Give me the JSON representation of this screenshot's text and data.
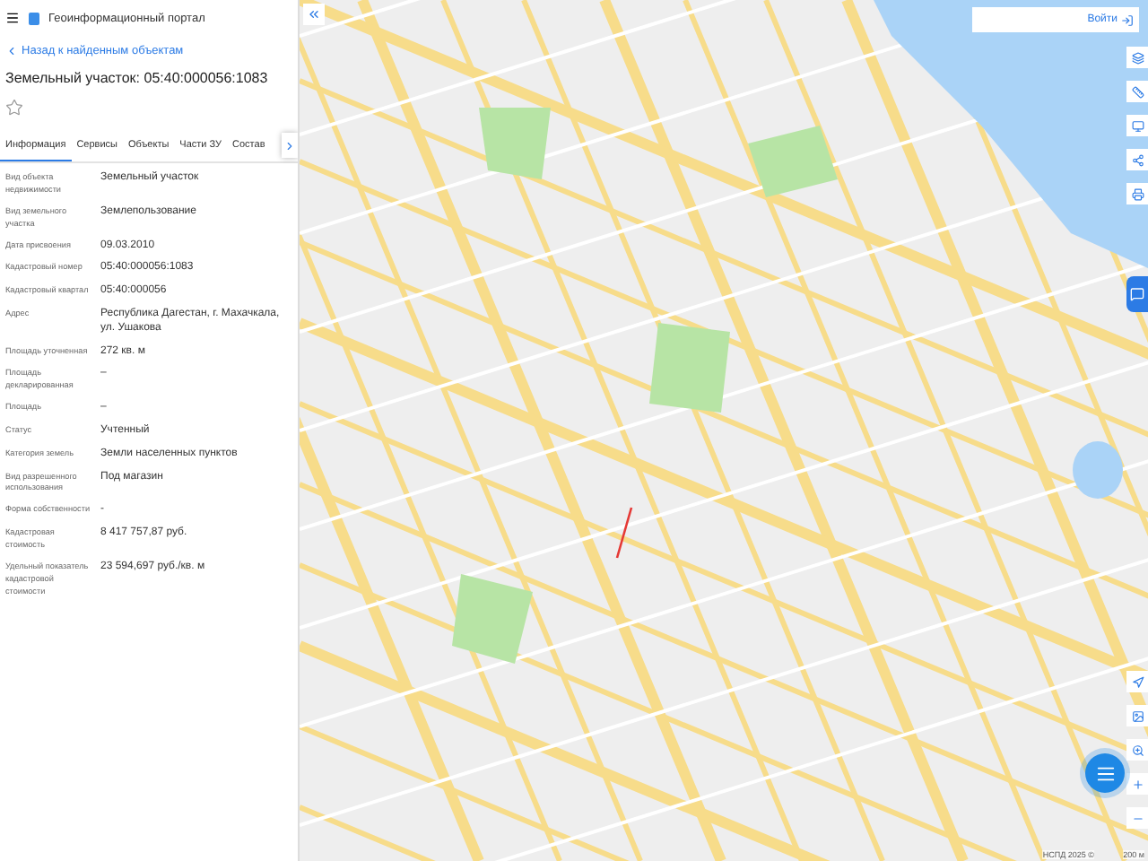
{
  "header": {
    "title": "Геоинформационный портал"
  },
  "back_link": "Назад к найденным объектам",
  "object_title": "Земельный участок: 05:40:000056:1083",
  "favorite": false,
  "tabs": [
    {
      "label": "Информация",
      "selected": true
    },
    {
      "label": "Сервисы",
      "selected": false
    },
    {
      "label": "Объекты",
      "selected": false
    },
    {
      "label": "Части ЗУ",
      "selected": false
    },
    {
      "label": "Состав",
      "selected": false
    }
  ],
  "properties": [
    {
      "label": "Вид объекта недвижимости",
      "value": "Земельный участок"
    },
    {
      "label": "Вид земельного участка",
      "value": "Землепользование"
    },
    {
      "label": "Дата присвоения",
      "value": "09.03.2010"
    },
    {
      "label": "Кадастровый номер",
      "value": "05:40:000056:1083"
    },
    {
      "label": "Кадастровый квартал",
      "value": "05:40:000056"
    },
    {
      "label": "Адрес",
      "value": "Республика Дагестан, г. Махачкала, ул. Ушакова"
    },
    {
      "label": "Площадь уточненная",
      "value": "272 кв. м"
    },
    {
      "label": "Площадь декларированная",
      "value": "–"
    },
    {
      "label": "Площадь",
      "value": "–"
    },
    {
      "label": "Статус",
      "value": "Учтенный"
    },
    {
      "label": "Категория земель",
      "value": "Земли населенных пунктов"
    },
    {
      "label": "Вид разрешенного использования",
      "value": "Под магазин"
    },
    {
      "label": "Форма собственности",
      "value": "-"
    },
    {
      "label": "Кадастровая стоимость",
      "value": "8 417 757,87 руб."
    },
    {
      "label": "Удельный показатель кадастровой стоимости",
      "value": "23 594,697 руб./кв. м"
    }
  ],
  "map": {
    "login": "Войти",
    "attribution": "НСПД 2025 ©",
    "scale": "200 м"
  }
}
